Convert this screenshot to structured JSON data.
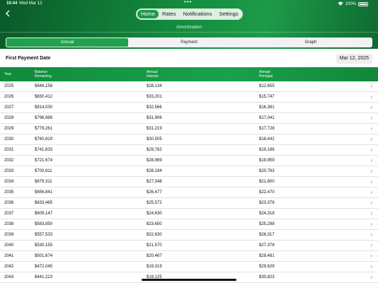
{
  "status": {
    "time": "10:44",
    "date": "Wed Mar 12",
    "battery": "100%"
  },
  "nav": {
    "tabs": [
      "Home",
      "Rates",
      "Notifications",
      "Settings"
    ],
    "active_index": 0
  },
  "page": {
    "subtitle": "Amortization"
  },
  "view_tabs": {
    "tabs": [
      "Annual",
      "Payment",
      "Graph"
    ],
    "active_index": 0
  },
  "first_payment": {
    "label": "First Payment Date",
    "date": "Mar 12, 2025"
  },
  "table": {
    "headers": {
      "year": "Year",
      "balance_line1": "Balance",
      "balance_line2": "Remaining",
      "interest_line1": "Annual",
      "interest_line2": "Interest",
      "principal_line1": "Annual",
      "principal_line2": "Principal"
    },
    "rows": [
      {
        "year": "2025",
        "balance": "$846,158",
        "interest": "$28,134",
        "principal": "$12,655"
      },
      {
        "year": "2026",
        "balance": "$830,412",
        "interest": "$33,201",
        "principal": "$15,747"
      },
      {
        "year": "2027",
        "balance": "$814,030",
        "interest": "$32,566",
        "principal": "$16,381"
      },
      {
        "year": "2028",
        "balance": "$796,989",
        "interest": "$31,906",
        "principal": "$17,041"
      },
      {
        "year": "2029",
        "balance": "$779,261",
        "interest": "$31,219",
        "principal": "$17,728"
      },
      {
        "year": "2030",
        "balance": "$760,819",
        "interest": "$30,505",
        "principal": "$18,442"
      },
      {
        "year": "2031",
        "balance": "$741,633",
        "interest": "$29,762",
        "principal": "$19,186"
      },
      {
        "year": "2032",
        "balance": "$721,674",
        "interest": "$28,989",
        "principal": "$19,959"
      },
      {
        "year": "2033",
        "balance": "$700,911",
        "interest": "$28,184",
        "principal": "$20,763"
      },
      {
        "year": "2034",
        "balance": "$679,311",
        "interest": "$27,348",
        "principal": "$21,600"
      },
      {
        "year": "2035",
        "balance": "$656,841",
        "interest": "$26,477",
        "principal": "$22,470"
      },
      {
        "year": "2036",
        "balance": "$633,465",
        "interest": "$25,572",
        "principal": "$23,376"
      },
      {
        "year": "2037",
        "balance": "$609,147",
        "interest": "$24,630",
        "principal": "$24,318"
      },
      {
        "year": "2038",
        "balance": "$583,850",
        "interest": "$23,650",
        "principal": "$25,298"
      },
      {
        "year": "2039",
        "balance": "$557,533",
        "interest": "$22,630",
        "principal": "$26,317"
      },
      {
        "year": "2040",
        "balance": "$530,155",
        "interest": "$21,570",
        "principal": "$27,378"
      },
      {
        "year": "2041",
        "balance": "$501,674",
        "interest": "$20,467",
        "principal": "$28,481"
      },
      {
        "year": "2042",
        "balance": "$472,045",
        "interest": "$19,319",
        "principal": "$29,629"
      },
      {
        "year": "2043",
        "balance": "$441,223",
        "interest": "$18,125",
        "principal": "$30,823"
      }
    ]
  }
}
